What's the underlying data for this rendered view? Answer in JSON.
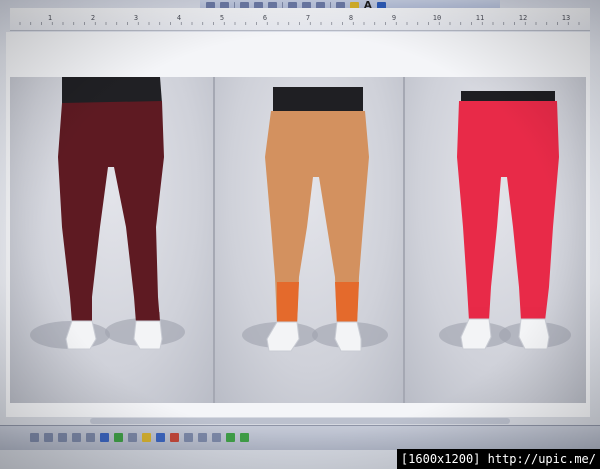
{
  "watermark": {
    "text": "[1600x1200] http://upic.me/"
  },
  "ruler": {
    "numbers": [
      "1",
      "2",
      "3",
      "4",
      "5",
      "6",
      "7",
      "8",
      "9",
      "10",
      "11",
      "12",
      "13"
    ]
  },
  "photo": {
    "panels": [
      {
        "legging_color": "#5e1a22",
        "top_color": "#202024",
        "ankle_color": "#5e1a22"
      },
      {
        "legging_color": "#d3915f",
        "top_color": "#1f1f23",
        "ankle_color": "#e46a2c"
      },
      {
        "legging_color": "#e82a48",
        "top_color": "#1e1e22",
        "ankle_color": "#e82a48"
      }
    ],
    "shoe_color": "#f3f4f6"
  }
}
